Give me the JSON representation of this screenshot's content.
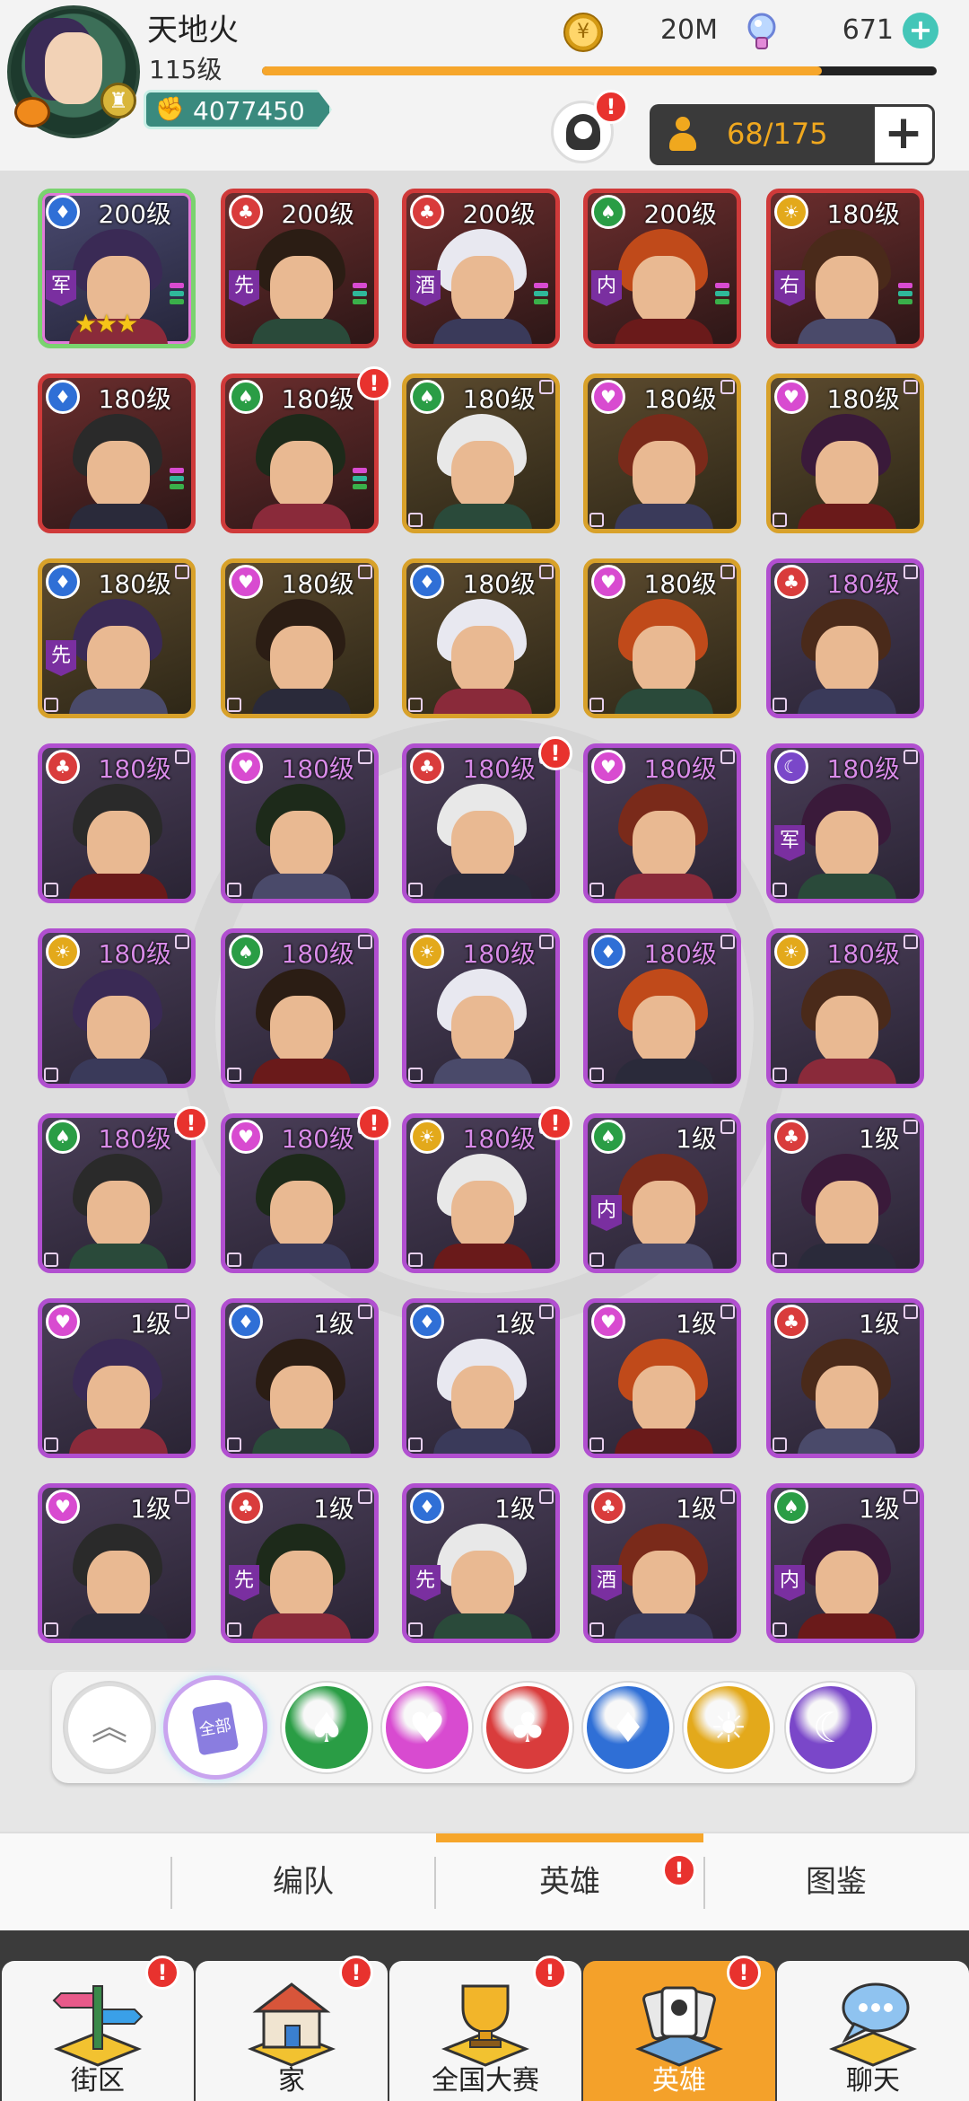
{
  "player": {
    "name": "天地火",
    "level": "115级",
    "power": "4077450",
    "xp_fraction": 0.83
  },
  "currency": {
    "coins": "20M",
    "gems": "671"
  },
  "capacity": {
    "text": "68/175"
  },
  "heroes": [
    {
      "level": "200级",
      "faction": "diamond",
      "role": "军",
      "border": "rainbow",
      "stars": "★★★",
      "alert": false
    },
    {
      "level": "200级",
      "faction": "club",
      "role": "先",
      "border": "red",
      "alert": false
    },
    {
      "level": "200级",
      "faction": "club",
      "role": "酒",
      "border": "red",
      "alert": false
    },
    {
      "level": "200级",
      "faction": "spade",
      "role": "内",
      "border": "red",
      "alert": false
    },
    {
      "level": "180级",
      "faction": "sun",
      "role": "右",
      "border": "red",
      "alert": false
    },
    {
      "level": "180级",
      "faction": "diamond",
      "border": "red",
      "alert": false
    },
    {
      "level": "180级",
      "faction": "spade",
      "border": "red",
      "alert": true
    },
    {
      "level": "180级",
      "faction": "spade",
      "border": "gold",
      "alert": false
    },
    {
      "level": "180级",
      "faction": "heart",
      "border": "gold",
      "alert": false
    },
    {
      "level": "180级",
      "faction": "heart",
      "border": "gold",
      "alert": false
    },
    {
      "level": "180级",
      "faction": "diamond",
      "role": "先",
      "border": "gold",
      "alert": false
    },
    {
      "level": "180级",
      "faction": "heart",
      "border": "gold",
      "alert": false
    },
    {
      "level": "180级",
      "faction": "diamond",
      "border": "gold",
      "alert": false
    },
    {
      "level": "180级",
      "faction": "heart",
      "border": "gold",
      "alert": false
    },
    {
      "level": "180级",
      "faction": "club",
      "border": "purple",
      "alert": false
    },
    {
      "level": "180级",
      "faction": "club",
      "border": "purple",
      "alert": false
    },
    {
      "level": "180级",
      "faction": "heart",
      "border": "purple",
      "alert": false
    },
    {
      "level": "180级",
      "faction": "club",
      "border": "purple",
      "alert": true
    },
    {
      "level": "180级",
      "faction": "heart",
      "border": "purple",
      "alert": false
    },
    {
      "level": "180级",
      "faction": "moon",
      "role": "军",
      "border": "purple",
      "alert": false
    },
    {
      "level": "180级",
      "faction": "sun",
      "border": "purple",
      "alert": false
    },
    {
      "level": "180级",
      "faction": "spade",
      "border": "purple",
      "alert": false
    },
    {
      "level": "180级",
      "faction": "sun",
      "border": "purple",
      "alert": false
    },
    {
      "level": "180级",
      "faction": "diamond",
      "border": "purple",
      "alert": false
    },
    {
      "level": "180级",
      "faction": "sun",
      "border": "purple",
      "alert": false
    },
    {
      "level": "180级",
      "faction": "spade",
      "border": "purple",
      "alert": true
    },
    {
      "level": "180级",
      "faction": "heart",
      "border": "purple",
      "alert": true
    },
    {
      "level": "180级",
      "faction": "sun",
      "border": "purple",
      "alert": true
    },
    {
      "level": "1级",
      "faction": "spade",
      "role": "内",
      "border": "purple",
      "alert": false
    },
    {
      "level": "1级",
      "faction": "club",
      "border": "purple",
      "alert": false
    },
    {
      "level": "1级",
      "faction": "heart",
      "border": "purple",
      "alert": false
    },
    {
      "level": "1级",
      "faction": "diamond",
      "border": "purple",
      "alert": false
    },
    {
      "level": "1级",
      "faction": "diamond",
      "border": "purple",
      "alert": false
    },
    {
      "level": "1级",
      "faction": "heart",
      "border": "purple",
      "alert": false
    },
    {
      "level": "1级",
      "faction": "club",
      "border": "purple",
      "alert": false
    },
    {
      "level": "1级",
      "faction": "heart",
      "border": "purple",
      "alert": false
    },
    {
      "level": "1级",
      "faction": "club",
      "role": "先",
      "border": "purple",
      "alert": false
    },
    {
      "level": "1级",
      "faction": "diamond",
      "role": "先",
      "border": "purple",
      "alert": false
    },
    {
      "level": "1级",
      "faction": "club",
      "role": "酒",
      "border": "purple",
      "alert": false
    },
    {
      "level": "1级",
      "faction": "spade",
      "role": "内",
      "border": "purple",
      "alert": false
    }
  ],
  "filters": {
    "all_label": "全部",
    "items": [
      "spade",
      "heart",
      "club",
      "diamond",
      "sun",
      "moon"
    ]
  },
  "faction_colors": {
    "spade": "#2a9d45",
    "heart": "#d84bd0",
    "club": "#d93c3c",
    "diamond": "#2f6fd6",
    "sun": "#e3a91b",
    "moon": "#7a47c9"
  },
  "faction_glyphs": {
    "spade": "♠",
    "heart": "♥",
    "club": "♣",
    "diamond": "♦",
    "sun": "☀",
    "moon": "☾"
  },
  "sub_tabs": {
    "formation": "编队",
    "heroes": "英雄",
    "codex": "图鉴"
  },
  "nav": {
    "street": "街区",
    "home": "家",
    "contest": "全国大赛",
    "heroes": "英雄",
    "chat": "聊天"
  }
}
